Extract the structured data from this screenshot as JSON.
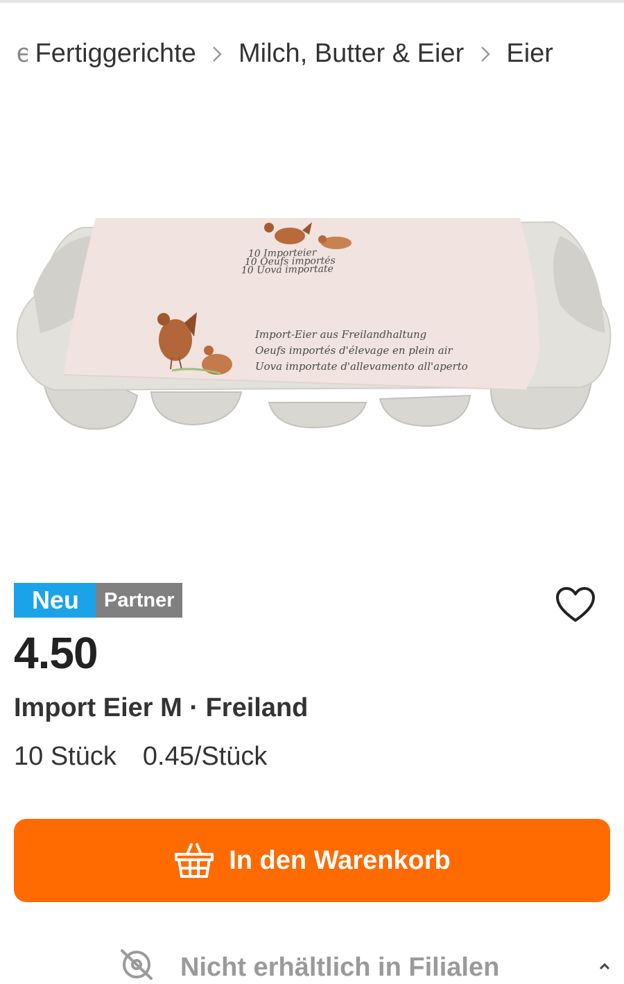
{
  "breadcrumb": {
    "leading_fragment": "e",
    "items": [
      "Fertiggerichte",
      "Milch, Butter & Eier",
      "Eier"
    ]
  },
  "product_image": {
    "sleeve_lines_top": [
      "10 Importeier",
      "10 Oeufs importés",
      "10 Uova importate"
    ],
    "sleeve_lines_bottom": [
      "Import-Eier aus Freilandhaltung",
      "Oeufs importés d'élevage en plein air",
      "Uova importate d'allevamento all'aperto"
    ]
  },
  "badges": {
    "new": "Neu",
    "partner": "Partner"
  },
  "price": "4.50",
  "title": "Import Eier M · Freiland",
  "quantity": {
    "amount": "10 Stück",
    "unit_price": "0.45/Stück"
  },
  "cart_button": {
    "label": "In den Warenkorb",
    "icon": "basket-icon"
  },
  "availability": {
    "text": "Nicht erhältlich in Filialen",
    "icon": "store-unavailable-icon"
  },
  "colors": {
    "accent": "#ff6b00",
    "badge_new": "#1aa3e8",
    "badge_partner": "#808080"
  }
}
